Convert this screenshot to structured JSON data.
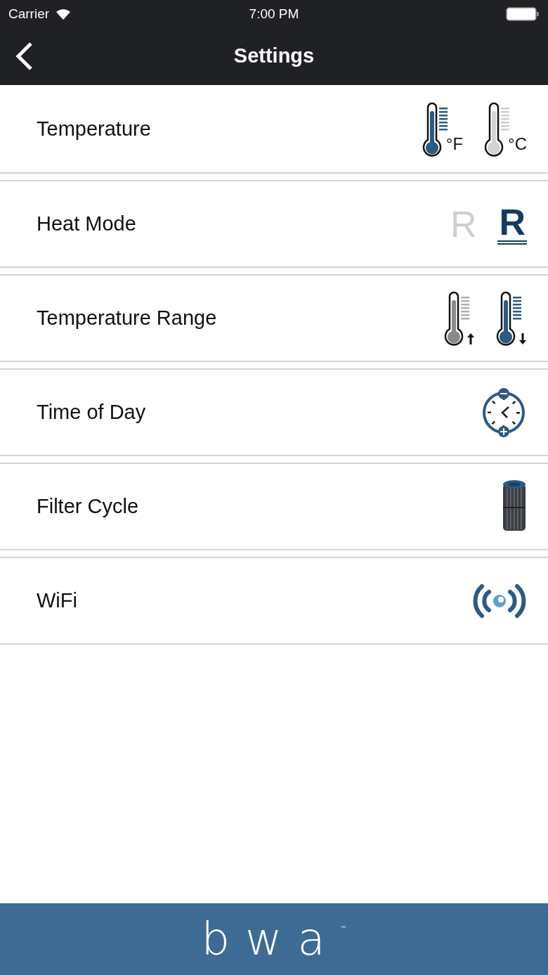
{
  "status_bar": {
    "carrier": "Carrier",
    "time": "7:00 PM"
  },
  "nav": {
    "title": "Settings"
  },
  "rows": [
    {
      "label": "Temperature",
      "options": [
        {
          "kind": "thermometer",
          "unit": "°F",
          "selected": true
        },
        {
          "kind": "thermometer",
          "unit": "°C",
          "selected": false
        }
      ]
    },
    {
      "label": "Heat Mode",
      "options": [
        {
          "kind": "letter",
          "text": "R",
          "selected": false
        },
        {
          "kind": "letter",
          "text": "R",
          "selected": true
        }
      ]
    },
    {
      "label": "Temperature Range",
      "options": [
        {
          "kind": "thermometer",
          "rising": true,
          "selected": false
        },
        {
          "kind": "thermometer",
          "rising": false,
          "selected": true
        }
      ]
    },
    {
      "label": "Time of Day",
      "options": [
        {
          "kind": "clock"
        }
      ]
    },
    {
      "label": "Filter Cycle",
      "options": [
        {
          "kind": "filter"
        }
      ]
    },
    {
      "label": "WiFi",
      "options": [
        {
          "kind": "wifi"
        }
      ]
    }
  ],
  "footer": {
    "logo": "bwa",
    "trademark": "™"
  }
}
